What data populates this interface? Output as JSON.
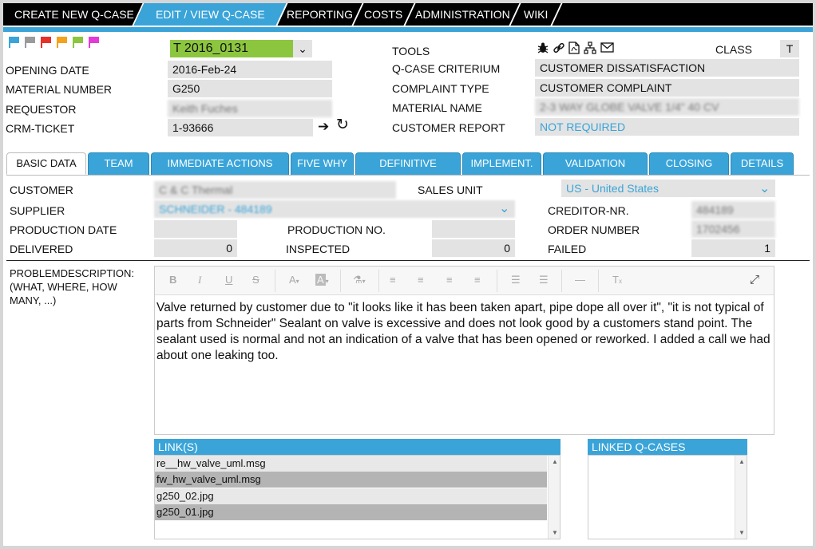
{
  "nav": {
    "items": [
      {
        "label": "CREATE NEW Q-CASE"
      },
      {
        "label": "EDIT / VIEW Q-CASE"
      },
      {
        "label": "REPORTING"
      },
      {
        "label": "COSTS"
      },
      {
        "label": "ADMINISTRATION"
      },
      {
        "label": "WIKI"
      }
    ]
  },
  "colors": {
    "accent": "#3aa4d8",
    "case_id_bg": "#8cc63f",
    "flags": [
      "#3aa4d8",
      "#9a9a9a",
      "#e8302a",
      "#f4a21b",
      "#8cc63f",
      "#e33cd6"
    ]
  },
  "header": {
    "case_id": "T 2016_0131",
    "opening_date_label": "OPENING DATE",
    "opening_date": "2016-Feb-24",
    "material_number_label": "MATERIAL NUMBER",
    "material_number": "G250",
    "requestor_label": "REQUESTOR",
    "requestor": "Keith Fuches",
    "crm_ticket_label": "CRM-TICKET",
    "crm_ticket": "1-93666",
    "tools_label": "TOOLS",
    "class_label": "CLASS",
    "class_value": "T",
    "criterium_label": "Q-CASE CRITERIUM",
    "criterium": "CUSTOMER DISSATISFACTION",
    "complaint_type_label": "COMPLAINT TYPE",
    "complaint_type": "CUSTOMER COMPLAINT",
    "material_name_label": "MATERIAL NAME",
    "material_name": "2-3 WAY GLOBE VALVE 1/4\" 40 CV",
    "customer_report_label": "CUSTOMER REPORT",
    "customer_report": "NOT REQUIRED"
  },
  "tabs": [
    {
      "label": "BASIC DATA"
    },
    {
      "label": "TEAM"
    },
    {
      "label": "IMMEDIATE ACTIONS"
    },
    {
      "label": "FIVE WHY"
    },
    {
      "label": "DEFINITIVE ACTIONS"
    },
    {
      "label": "IMPLEMENT."
    },
    {
      "label": "VALIDATION"
    },
    {
      "label": "CLOSING"
    },
    {
      "label": "DETAILS"
    }
  ],
  "basic": {
    "customer_label": "CUSTOMER",
    "customer": "C & C Thermal",
    "sales_unit_label": "SALES UNIT",
    "sales_unit": "US - United States",
    "supplier_label": "SUPPLIER",
    "supplier": "SCHNEIDER - 484189",
    "creditor_label": "CREDITOR-NR.",
    "creditor": "484189",
    "production_date_label": "PRODUCTION DATE",
    "production_date": "",
    "production_no_label": "PRODUCTION NO.",
    "production_no": "",
    "order_number_label": "ORDER NUMBER",
    "order_number": "1702456",
    "delivered_label": "DELIVERED",
    "delivered": "0",
    "inspected_label": "INSPECTED",
    "inspected": "0",
    "failed_label": "FAILED",
    "failed": "1",
    "problem_label": "PROBLEMDESCRIPTION: (WHAT, WHERE, HOW MANY, ...)",
    "problem_text": "Valve returned by customer due to \"it looks like it has been taken apart, pipe dope all over it\", \"it is not typical of parts from Schneider\" Sealant on valve is excessive and does not look good by a customers stand point. The sealant used is normal and not an indication of a valve that has been opened or reworked. I added a call we had about one leaking too."
  },
  "links": {
    "header": "LINK(S)",
    "items": [
      {
        "name": "re__hw_valve_uml.msg"
      },
      {
        "name": "fw_hw_valve_uml.msg"
      },
      {
        "name": "g250_02.jpg"
      },
      {
        "name": "g250_01.jpg"
      }
    ]
  },
  "linked_cases": {
    "header": "LINKED Q-CASES",
    "items": []
  }
}
